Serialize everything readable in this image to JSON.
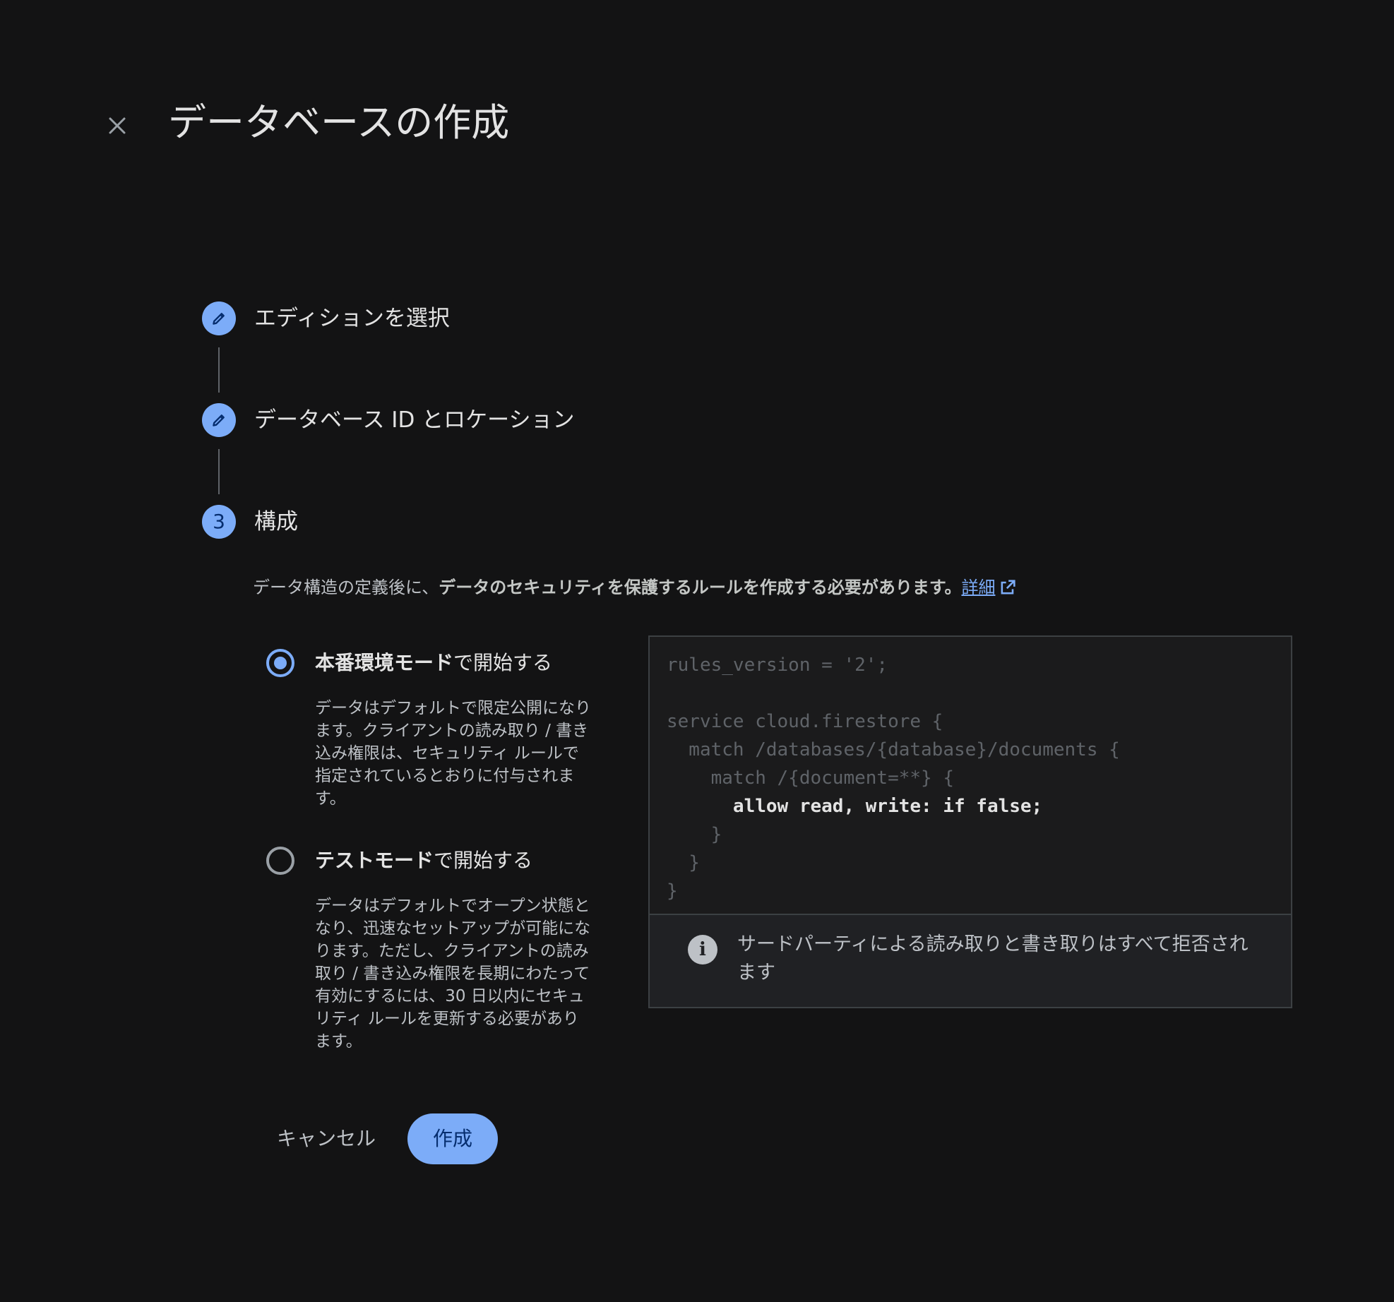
{
  "header": {
    "close_icon": "close-icon",
    "title": "データベースの作成"
  },
  "stepper": {
    "steps": [
      {
        "label": "エディションを選択",
        "icon": "pencil-icon",
        "state": "completed"
      },
      {
        "label": "データベース ID とロケーション",
        "icon": "pencil-icon",
        "state": "completed"
      },
      {
        "label": "構成",
        "number": "3",
        "state": "active"
      }
    ]
  },
  "configure": {
    "intro_plain": "データ構造の定義後に、",
    "intro_strong": "データのセキュリティを保護するルールを作成する必要があります。",
    "learn_more": "詳細",
    "learn_more_icon": "open-in-new-icon",
    "options": [
      {
        "title_bold": "本番環境モード",
        "title_rest": "で開始する",
        "selected": true,
        "description": "データはデフォルトで限定公開になります。クライアントの読み取り / 書き込み権限は、セキュリティ ルールで指定されているとおりに付与されます。"
      },
      {
        "title_bold": "テストモード",
        "title_rest": "で開始する",
        "selected": false,
        "description": "データはデフォルトでオープン状態となり、迅速なセットアップが可能になります。ただし、クライアントの読み取り / 書き込み権限を長期にわたって有効にするには、30 日以内にセキュリティ ルールを更新する必要があります。"
      }
    ],
    "rules": {
      "code_before": "rules_version = '2';\n\nservice cloud.firestore {\n  match /databases/{database}/documents {\n    match /{document=**} {\n",
      "code_highlight": "      allow read, write: if false;",
      "code_after": "\n    }\n  }\n}",
      "info_icon": "info-icon",
      "info_text": "サードパーティによる読み取りと書き取りはすべて拒否されます"
    }
  },
  "actions": {
    "cancel_label": "キャンセル",
    "create_label": "作成"
  },
  "colors": {
    "background": "#131314",
    "accent": "#7cacf8",
    "text": "#e3e3e3",
    "muted_text": "#bdc1c6"
  }
}
